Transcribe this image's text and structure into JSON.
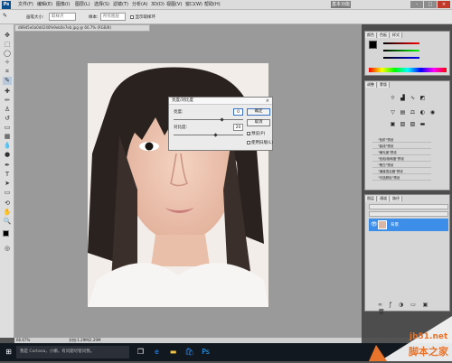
{
  "app": {
    "logo": "Ps",
    "mode_button": "基本功能"
  },
  "menu": [
    "文件(F)",
    "编辑(E)",
    "图像(I)",
    "图层(L)",
    "选择(S)",
    "滤镜(T)",
    "分析(A)",
    "3D(D)",
    "视图(V)",
    "窗口(W)",
    "帮助(H)"
  ],
  "options": {
    "size_label": "画笔大小:",
    "size_value": "取样点",
    "sample_label": "样本:",
    "sample_value": "所有图层",
    "checkbox_label": "显示取样环"
  },
  "document": {
    "tab": "d89d5e0a0d4240fe9eb0e7eb.jpg @ 66.7% (RGB/8)",
    "zoom": "66.67%",
    "doc_size": "文档:1.29M/2.29M"
  },
  "dialog": {
    "title": "亮度/对比度",
    "brightness_label": "亮度:",
    "brightness_value": "0",
    "contrast_label": "对比度:",
    "contrast_value": "20",
    "ok": "确定",
    "cancel": "取消",
    "preview_label": "预览(P)",
    "legacy_label": "使用旧版(L)"
  },
  "panels": {
    "color_tabs": [
      "颜色",
      "色板",
      "样式"
    ],
    "adjust_tabs": [
      "调整",
      "蒙版"
    ],
    "presets": [
      "\"色阶\"预设",
      "\"曲线\"预设",
      "\"曝光度\"预设",
      "\"色相/饱和度\"预设",
      "\"黑白\"预设",
      "\"通道混合器\"预设",
      "\"可选颜色\"预设"
    ],
    "layers_tabs": [
      "图层",
      "通道",
      "路径"
    ],
    "layer_name": "背景"
  },
  "taskbar": {
    "search_placeholder": "我是 Cortana，小娜。有问题尽管问我。"
  },
  "watermark": {
    "site": "jb51.net",
    "name": "脚本之家"
  },
  "colors": {
    "selection_blue": "#3d8ee8",
    "watermark_orange": "#e8732a"
  }
}
